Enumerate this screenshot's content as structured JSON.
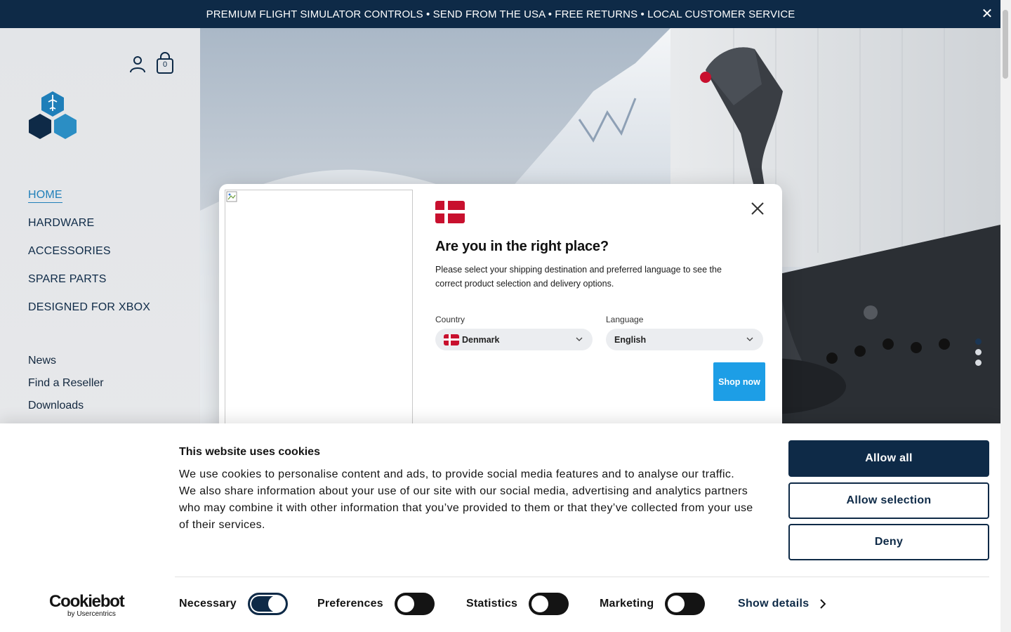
{
  "banner": {
    "text": "PREMIUM FLIGHT SIMULATOR CONTROLS  •  SEND FROM THE USA  •  FREE RETURNS  •  LOCAL CUSTOMER SERVICE",
    "close_label": "✕"
  },
  "header": {
    "cart_count": "0"
  },
  "nav": {
    "main": [
      {
        "label": "HOME",
        "active": true
      },
      {
        "label": "HARDWARE"
      },
      {
        "label": "ACCESSORIES"
      },
      {
        "label": "SPARE PARTS"
      },
      {
        "label": "DESIGNED FOR XBOX"
      }
    ],
    "secondary": [
      {
        "label": "News"
      },
      {
        "label": "Find a Reseller"
      },
      {
        "label": "Downloads"
      }
    ]
  },
  "modal": {
    "title": "Are you in the right place?",
    "description": "Please select your shipping destination and preferred language to see the correct product selection and delivery options.",
    "country_label": "Country",
    "country_value": "Denmark",
    "language_label": "Language",
    "language_value": "English",
    "shop_button": "Shop now"
  },
  "cookie": {
    "title": "This website uses cookies",
    "text": "We use cookies to personalise content and ads, to provide social media features and to analyse our traffic. We also share information about your use of our site with our social media, advertising and analytics partners who may combine it with other information that you’ve provided to them or that they’ve collected from your use of their services.",
    "allow_all": "Allow all",
    "allow_selection": "Allow selection",
    "deny": "Deny",
    "brand_main": "Cookiebot",
    "brand_sub": "by Usercentrics",
    "toggles": [
      {
        "label": "Necessary",
        "on": true
      },
      {
        "label": "Preferences",
        "on": false
      },
      {
        "label": "Statistics",
        "on": false
      },
      {
        "label": "Marketing",
        "on": false
      }
    ],
    "show_details": "Show details"
  },
  "colors": {
    "brand_navy": "#0e2a47",
    "accent_blue": "#1f7fb9",
    "shop_button": "#1d9ee6",
    "flag_red": "#c8102e"
  }
}
